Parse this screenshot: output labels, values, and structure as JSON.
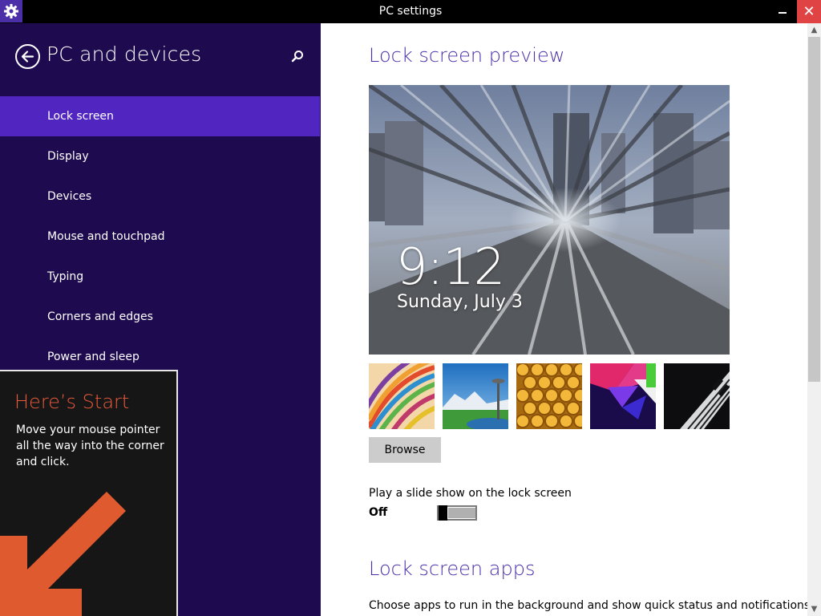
{
  "window": {
    "title": "PC settings"
  },
  "sidebar": {
    "title": "PC and devices",
    "items": [
      {
        "label": "Lock screen",
        "active": true
      },
      {
        "label": "Display",
        "active": false
      },
      {
        "label": "Devices",
        "active": false
      },
      {
        "label": "Mouse and touchpad",
        "active": false
      },
      {
        "label": "Typing",
        "active": false
      },
      {
        "label": "Corners and edges",
        "active": false
      },
      {
        "label": "Power and sleep",
        "active": false
      }
    ]
  },
  "tip": {
    "title": "Here’s Start",
    "body": "Move your mouse pointer all the way into the corner and click."
  },
  "main": {
    "preview_heading": "Lock screen preview",
    "clock": {
      "time": "9:12",
      "date": "Sunday, July 3"
    },
    "thumbnails": [
      "stripes",
      "space-needle",
      "honeycomb",
      "abstract",
      "piano"
    ],
    "browse_label": "Browse",
    "slideshow": {
      "label": "Play a slide show on the lock screen",
      "state": "Off"
    },
    "apps_heading": "Lock screen apps",
    "apps_description": "Choose apps to run in the background and show quick status and notifications,"
  },
  "colors": {
    "accent": "#4a2fa8",
    "sidebar_bg": "#1e0b4f",
    "active_item": "#5126c0",
    "close_red": "#e04343",
    "tip_title": "#ea5a3a"
  }
}
